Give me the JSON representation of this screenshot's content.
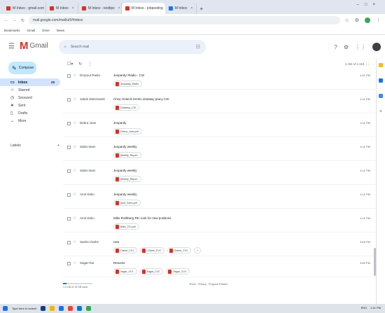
{
  "browser": {
    "tabs": [
      {
        "label": "M Inbox - gmail.com",
        "active": false
      },
      {
        "label": "M Inbox",
        "active": false
      },
      {
        "label": "M Inbox - tooltips",
        "active": false
      },
      {
        "label": "M Inbox - jobposting",
        "active": true
      },
      {
        "label": "M Inbox",
        "active": false
      }
    ],
    "new_tab": "+",
    "url": "mail.google.com/mail/u/0/#inbox",
    "bookmarks": [
      "Bookmarks",
      "Gmail",
      "Drive",
      "News"
    ]
  },
  "header": {
    "app_name": "Gmail",
    "search_placeholder": "Search mail"
  },
  "sidebar": {
    "compose_label": "Compose",
    "items": [
      {
        "label": "Inbox",
        "icon": "inbox-icon",
        "count": "25"
      },
      {
        "label": "Starred",
        "icon": "star-icon",
        "count": ""
      },
      {
        "label": "Snoozed",
        "icon": "clock-icon",
        "count": ""
      },
      {
        "label": "Sent",
        "icon": "send-icon",
        "count": ""
      },
      {
        "label": "Drafts",
        "icon": "draft-icon",
        "count": ""
      },
      {
        "label": "More",
        "icon": "chevron-down-icon",
        "count": ""
      }
    ],
    "labels_heading": "Labels",
    "labels_add": "+"
  },
  "toolbar": {
    "pager": "1–50 of 2,110"
  },
  "emails": [
    {
      "sender": "Dropout Radio",
      "subject": "Jeopardy! Radio - CSI",
      "date": "4:11 PM",
      "attachments": [
        "Jeopardy_Radio"
      ]
    },
    {
      "sender": "Jakub Zakrzewski",
      "subject": "Chcę zmienić termin dostawy pracy CSI",
      "date": "4:11 PM",
      "attachments": [
        "Dostawa_CSI"
      ]
    },
    {
      "sender": "Debra Joan",
      "subject": "Jeopardy",
      "date": "4:11 PM",
      "attachments": [
        "Debra_Joan.pdf"
      ]
    },
    {
      "sender": "Sales team",
      "subject": "Jeopardy weekly",
      "date": "4:11 PM",
      "attachments": [
        "Weekly_Report"
      ]
    },
    {
      "sender": "Sales team",
      "subject": "Jeopardy weekly",
      "date": "4:11 PM",
      "attachments": [
        "Weekly_Report"
      ]
    },
    {
      "sender": "Amit Sahu",
      "subject": "Jeopardy weekly",
      "date": "4:11 PM",
      "attachments": [
        "Amit_Sahu.pdf"
      ]
    },
    {
      "sender": "Amit Sahu",
      "subject": "Mike Rothberg RE: look for new positions",
      "date": "4:11 PM",
      "attachments": [
        "Mike_CSI.pdf"
      ]
    },
    {
      "sender": "Sasha Clarke",
      "subject": "new",
      "date": "3:55 PM",
      "attachments": [
        "Clarke_CV1",
        "Clarke_CV2",
        "Clarke_CV3"
      ],
      "more": "+"
    },
    {
      "sender": "Sagar Rai",
      "subject": "Resume",
      "date": "3:55 PM",
      "attachments": [
        "Sagar_CV1",
        "Sagar_CV2",
        "Sagar_CV3"
      ]
    }
  ],
  "footer": {
    "storage_used_fraction": 0.11,
    "storage_text": "1.5 GB of 15 GB used",
    "middle_text": "Terms · Privacy · Program Policies"
  },
  "taskbar": {
    "search": "Type here to search",
    "tray": [
      "ENG",
      "4:11 PM"
    ]
  }
}
